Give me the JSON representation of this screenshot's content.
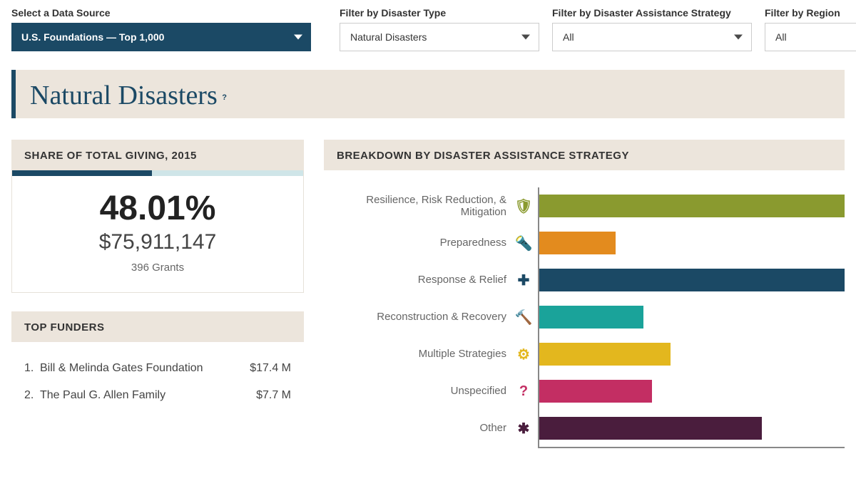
{
  "filters": {
    "source_label": "Select a Data Source",
    "source_value": "U.S. Foundations — Top 1,000",
    "disaster_label": "Filter by Disaster Type",
    "disaster_value": "Natural Disasters",
    "strategy_label": "Filter by Disaster Assistance Strategy",
    "strategy_value": "All",
    "region_label": "Filter by Region",
    "region_value": "All"
  },
  "page_title": "Natural Disasters",
  "share": {
    "header": "SHARE OF TOTAL GIVING, 2015",
    "percent": "48.01%",
    "amount": "$75,911,147",
    "grants": "396 Grants"
  },
  "funders": {
    "header": "TOP FUNDERS",
    "rows": [
      {
        "n": "1.",
        "name": "Bill & Melinda Gates Foundation",
        "value": "$17.4 M"
      },
      {
        "n": "2.",
        "name": "The Paul G. Allen Family",
        "value": "$7.7 M"
      }
    ]
  },
  "chart": {
    "header": "BREAKDOWN BY DISASTER ASSISTANCE STRATEGY"
  },
  "chart_data": {
    "type": "bar",
    "orientation": "horizontal",
    "title": "Breakdown by Disaster Assistance Strategy",
    "xlabel": "",
    "ylabel": "",
    "note": "X-axis has no visible tick labels; values are relative bar lengths on a 0–100 scale estimated from pixel widths.",
    "categories": [
      "Resilience, Risk Reduction, & Mitigation",
      "Preparedness",
      "Response & Relief",
      "Reconstruction & Recovery",
      "Multiple Strategies",
      "Unspecified",
      "Other"
    ],
    "values": [
      100,
      25,
      100,
      34,
      43,
      37,
      73
    ],
    "colors": [
      "#8a9a2f",
      "#e38b1e",
      "#1b4965",
      "#1aa39a",
      "#e3b71e",
      "#c32e63",
      "#4a1d3d"
    ],
    "icons": [
      "shield-icon",
      "flashlight-icon",
      "medical-cross-icon",
      "hammer-icon",
      "gears-icon",
      "question-icon",
      "asterisk-icon"
    ],
    "xlim": [
      0,
      100
    ]
  }
}
